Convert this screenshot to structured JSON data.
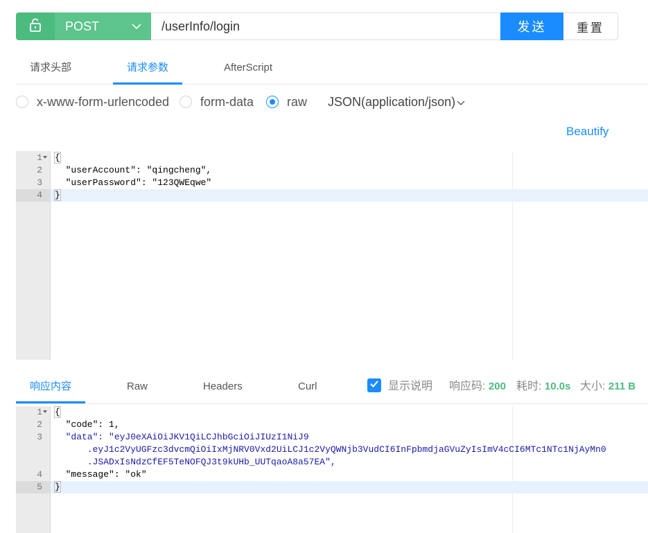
{
  "request": {
    "method": "POST",
    "url": "/userInfo/login",
    "send_label": "发送",
    "reset_label": "重置"
  },
  "request_tabs": [
    "请求头部",
    "请求参数",
    "AfterScript"
  ],
  "body_types": {
    "options": [
      "x-www-form-urlencoded",
      "form-data",
      "raw"
    ],
    "selected": "raw",
    "content_type": "JSON(application/json)"
  },
  "beautify_label": "Beautify",
  "request_body": {
    "line_numbers": [
      "1",
      "2",
      "3",
      "4"
    ],
    "lines": [
      "{",
      "  \"userAccount\": \"qingcheng\",",
      "  \"userPassword\": \"123QWEqwe\"",
      "}"
    ],
    "active_line": 4
  },
  "response_tabs": [
    "响应内容",
    "Raw",
    "Headers",
    "Curl"
  ],
  "response_meta": {
    "show_desc_label": "显示说明",
    "show_desc_checked": true,
    "status_label": "响应码:",
    "status_value": "200",
    "time_label": "耗时:",
    "time_value": "10.0s",
    "size_label": "大小:",
    "size_value": "211 B"
  },
  "response_body": {
    "line_numbers": [
      "1",
      "2",
      "3",
      "",
      "",
      "4",
      "5"
    ],
    "lines": [
      "{",
      "  \"code\": 1,",
      "  \"data\": \"eyJ0eXAiOiJKV1QiLCJhbGciOiJIUzI1NiJ9",
      "      .eyJ1c2VyUGFzc3dvcmQiOiIxMjNRV0Vxd2UiLCJ1c2VyQWNjb3VudCI6InFpbmdjaGVuZyIsImV4cCI6MTc1NTc1NjAyMn0",
      "      .JSADxIsNdzCfEF5TeNOFQJ3t9kUHb_UUTqaoA8a57EA\",",
      "  \"message\": \"ok\"",
      "}"
    ],
    "active_line": 5
  },
  "colors": {
    "accent": "#1a8cff",
    "method_green": "#5cc48c",
    "status_green": "#4cbb7f"
  }
}
